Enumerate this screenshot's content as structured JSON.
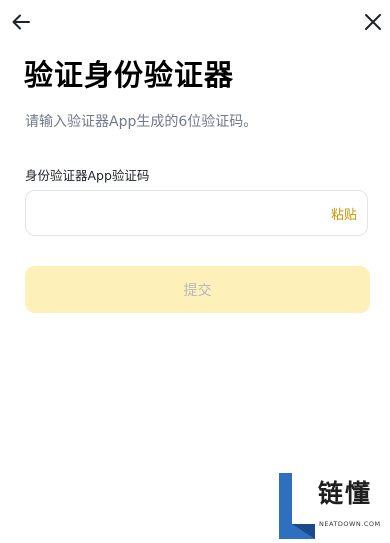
{
  "header": {
    "back_icon": "arrow-left-icon",
    "close_icon": "close-icon"
  },
  "page": {
    "title": "验证身份验证器",
    "subtitle": "请输入验证器App生成的6位验证码。"
  },
  "form": {
    "field_label": "身份验证器App验证码",
    "code_value": "",
    "code_placeholder": "",
    "paste_label": "粘贴",
    "submit_label": "提交"
  },
  "watermark": {
    "logo_text": "链懂",
    "sub_text": "NEATDOWN.COM"
  },
  "colors": {
    "accent": "#c99400",
    "submit_disabled_bg": "#fdf0b8",
    "submit_disabled_text": "#b6b9be",
    "subtitle_gray": "#707a8a",
    "watermark_blue": "#2f6fc0"
  }
}
